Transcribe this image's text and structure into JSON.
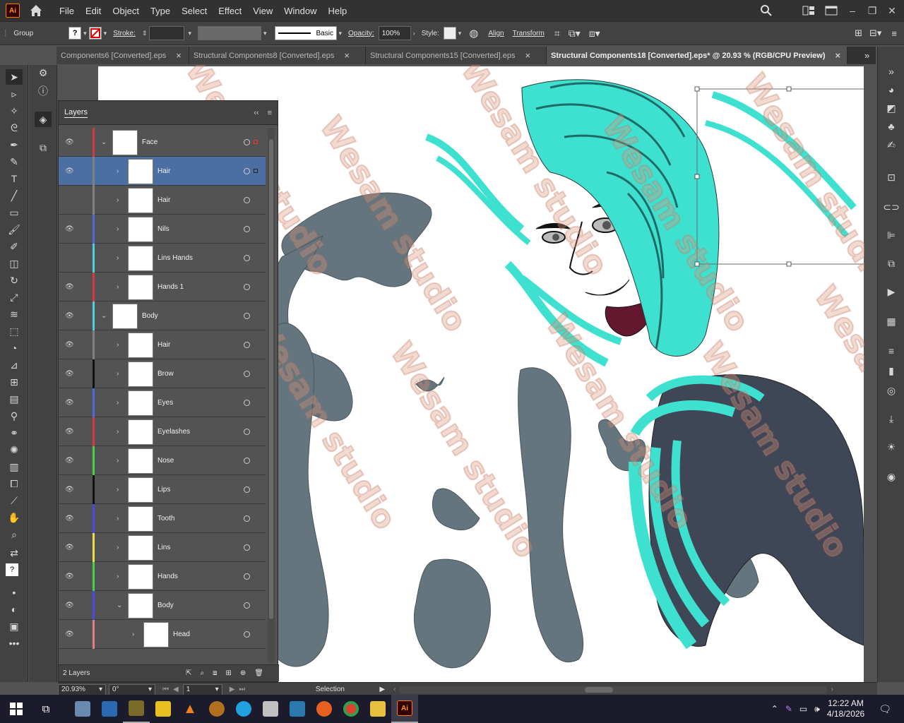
{
  "app": {
    "logo": "Ai"
  },
  "menu": [
    "File",
    "Edit",
    "Object",
    "Type",
    "Select",
    "Effect",
    "View",
    "Window",
    "Help"
  ],
  "control": {
    "selection_type": "Group",
    "stroke_label": "Stroke:",
    "brush_label": "Basic",
    "opacity_label": "Opacity:",
    "opacity_value": "100%",
    "style_label": "Style:",
    "align_label": "Align",
    "transform_label": "Transform"
  },
  "tabs": [
    {
      "label": "Components6 [Converted].eps",
      "close": "×"
    },
    {
      "label": "Structural Components8 [Converted].eps",
      "close": "×"
    },
    {
      "label": "Structural Components15 [Converted].eps",
      "close": "×"
    },
    {
      "label": "Structural Components18 [Converted].eps* @ 20.93 % (RGB/CPU Preview)",
      "close": "×"
    }
  ],
  "layers_panel": {
    "title": "Layers",
    "footer_count": "2 Layers",
    "rows": [
      {
        "name": "Face",
        "color": "#d33c3c",
        "visible": true,
        "expanded": true,
        "level": 0
      },
      {
        "name": "Hair",
        "color": "#808080",
        "visible": true,
        "expanded": false,
        "level": 1,
        "selected": true
      },
      {
        "name": "Hair",
        "color": "#808080",
        "visible": false,
        "expanded": false,
        "level": 1
      },
      {
        "name": "Nils",
        "color": "#4a6ce0",
        "visible": true,
        "expanded": false,
        "level": 1
      },
      {
        "name": "Lins Hands",
        "color": "#4ad0e0",
        "visible": false,
        "expanded": false,
        "level": 1
      },
      {
        "name": "Hands 1",
        "color": "#d33c3c",
        "visible": true,
        "expanded": false,
        "level": 1
      },
      {
        "name": "Body",
        "color": "#4ad0e0",
        "visible": true,
        "expanded": true,
        "level": 0
      },
      {
        "name": "Hair",
        "color": "#808080",
        "visible": true,
        "expanded": false,
        "level": 1
      },
      {
        "name": "Brow",
        "color": "#111111",
        "visible": true,
        "expanded": false,
        "level": 1
      },
      {
        "name": "Eyes",
        "color": "#4a6ce0",
        "visible": true,
        "expanded": false,
        "level": 1
      },
      {
        "name": "Eyelashes",
        "color": "#d33c3c",
        "visible": true,
        "expanded": false,
        "level": 1
      },
      {
        "name": "Nose",
        "color": "#4ad04a",
        "visible": true,
        "expanded": false,
        "level": 1
      },
      {
        "name": "Lips",
        "color": "#111111",
        "visible": true,
        "expanded": false,
        "level": 1
      },
      {
        "name": "Tooth",
        "color": "#4a4ae0",
        "visible": true,
        "expanded": false,
        "level": 1
      },
      {
        "name": "Lins",
        "color": "#e8e040",
        "visible": true,
        "expanded": false,
        "level": 1
      },
      {
        "name": "Hands",
        "color": "#4ad04a",
        "visible": true,
        "expanded": false,
        "level": 1
      },
      {
        "name": "Body",
        "color": "#4a4ae0",
        "visible": true,
        "expanded": true,
        "level": 1
      },
      {
        "name": "Head",
        "color": "#e08080",
        "visible": true,
        "expanded": false,
        "level": 2
      }
    ]
  },
  "status": {
    "zoom": "20.93%",
    "rotation": "0°",
    "artboard": "1",
    "tool": "Selection"
  },
  "watermark": "Wesam studio",
  "taskbar": {
    "time": "12:22 AM",
    "date": "4/18/2026"
  }
}
